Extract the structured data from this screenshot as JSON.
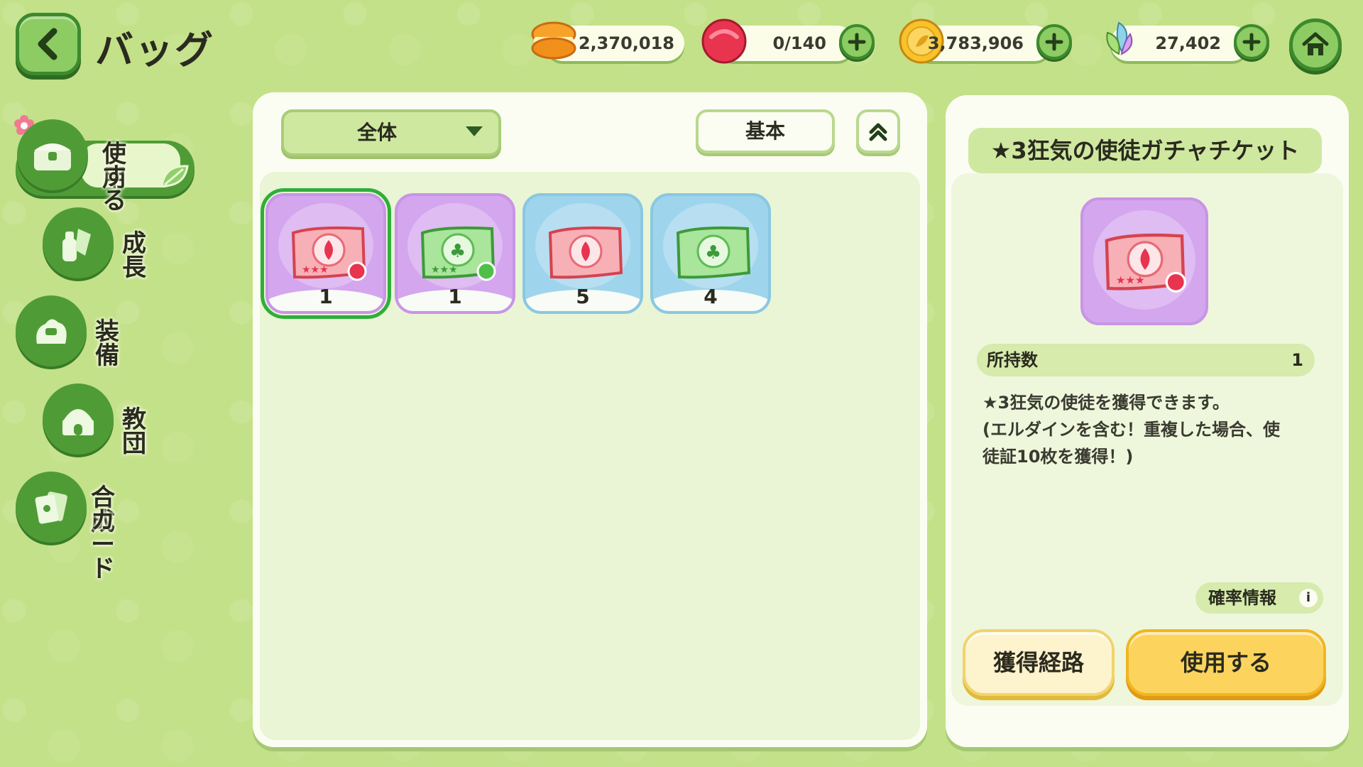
{
  "header": {
    "title": "バッグ"
  },
  "currencies": [
    {
      "name": "macaron",
      "value": "2,370,018",
      "has_plus": false
    },
    {
      "name": "candy",
      "value": "0/140",
      "has_plus": true
    },
    {
      "name": "gold-leaf-coin",
      "value": "3,783,906",
      "has_plus": true
    },
    {
      "name": "crystal-leaf",
      "value": "27,402",
      "has_plus": true
    }
  ],
  "sidebar": {
    "items": [
      {
        "label_line1": "使用",
        "label_line2": "する",
        "icon": "chest-icon",
        "active": true
      },
      {
        "label": "成長",
        "icon": "potion-icon",
        "active": false
      },
      {
        "label": "装備",
        "icon": "equipment-icon",
        "active": false
      },
      {
        "label": "教団",
        "icon": "temple-icon",
        "active": false
      },
      {
        "label_line1": "合成",
        "label_line2": "カード",
        "icon": "card-icon",
        "active": false
      }
    ]
  },
  "inventory": {
    "filter_label": "全体",
    "sort_label": "基本",
    "items": [
      {
        "type": "red-ticket-stars",
        "rarity": "purple",
        "count": "1",
        "selected": true
      },
      {
        "type": "green-ticket-stars",
        "rarity": "purple",
        "count": "1",
        "selected": false
      },
      {
        "type": "red-ticket",
        "rarity": "blue",
        "count": "5",
        "selected": false
      },
      {
        "type": "green-ticket",
        "rarity": "blue",
        "count": "4",
        "selected": false
      }
    ]
  },
  "detail": {
    "title": "★3狂気の使徒ガチャチケット",
    "owned_label": "所持数",
    "owned_value": "1",
    "description_lines": [
      "★3狂気の使徒を獲得できます。",
      "(エルダインを含む！重複した場合、使",
      "徒証10枚を獲得！)"
    ],
    "rate_info_label": "確率情報",
    "rate_info_icon": "i",
    "source_button": "獲得経路",
    "use_button": "使用する"
  },
  "colors": {
    "background": "#c3e188",
    "accent_green": "#4f9c37",
    "panel": "#fbfdf3",
    "rarity_purple": "#d4a6ee",
    "rarity_blue": "#9fd5ec",
    "use_button": "#fcd45d",
    "selected_outline": "#2fae3c"
  }
}
